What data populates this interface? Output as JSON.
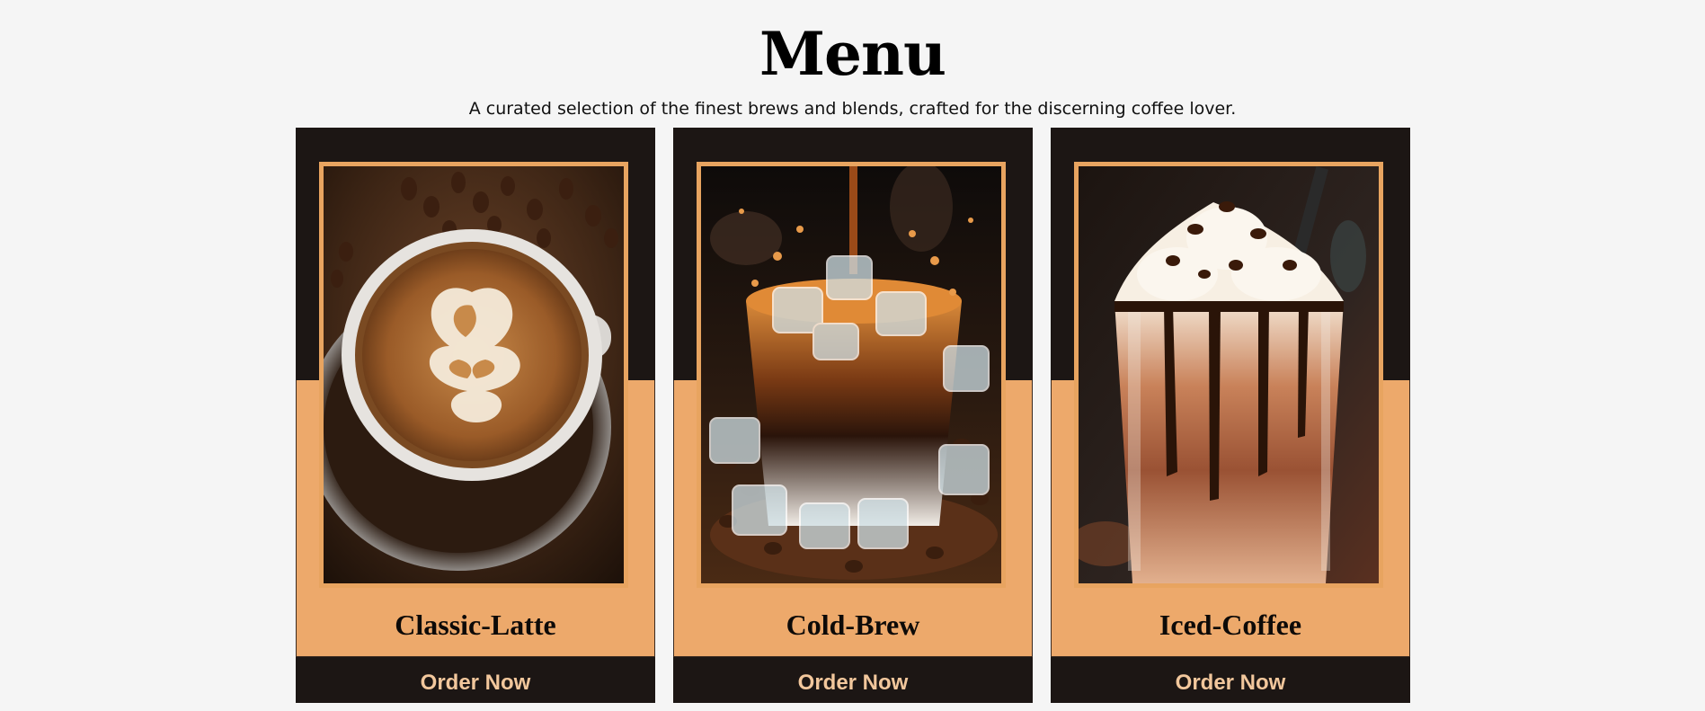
{
  "header": {
    "title": "Menu",
    "subtitle": "A curated selection of the finest brews and blends, crafted for the discerning coffee lover."
  },
  "colors": {
    "page_background": "#f5f5f5",
    "card_dark": "#1c1614",
    "card_accent": "#eda96b",
    "frame_border": "#e8a460",
    "button_text": "#f2c79c"
  },
  "products": [
    {
      "name": "Classic-Latte",
      "button_label": "Order Now",
      "image_subject": "latte-art-cup-image"
    },
    {
      "name": "Cold-Brew",
      "button_label": "Order Now",
      "image_subject": "cold-brew-glass-image"
    },
    {
      "name": "Iced-Coffee",
      "button_label": "Order Now",
      "image_subject": "iced-coffee-glass-image"
    }
  ]
}
